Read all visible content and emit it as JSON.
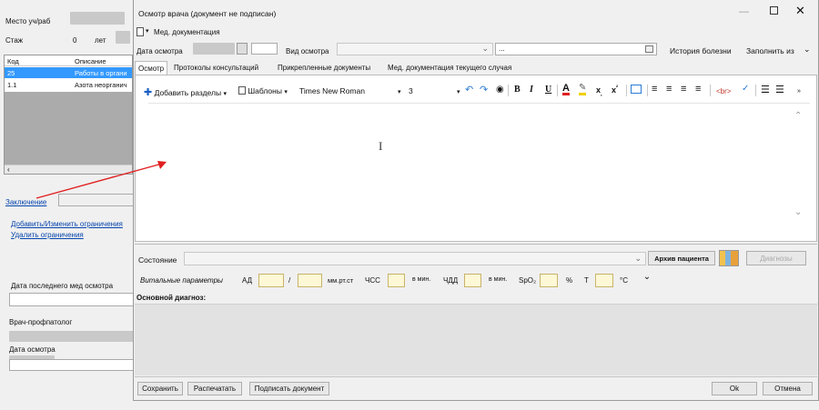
{
  "left": {
    "place_label": "Место уч/раб",
    "experience_label": "Стаж",
    "experience_value": "0",
    "experience_unit": "лет",
    "table": {
      "headers": [
        "Код",
        "Описание"
      ],
      "rows": [
        {
          "code": "25",
          "desc": "Работы в органи"
        },
        {
          "code": "1.1",
          "desc": "Азота неорганич"
        }
      ]
    },
    "conclusion_link": "Заключение",
    "add_restrictions_link": "Добавить/Изменить ограничения",
    "remove_restrictions_link": "Удалить ограничения",
    "last_exam_label": "Дата последнего мед осмотра",
    "pathologist_label": "Врач-профпатолог",
    "exam_date_label": "Дата осмотра"
  },
  "dialog": {
    "title": "Осмотр врача (документ не подписан)",
    "menu_label": "Мед. документация",
    "exam_date_label": "Дата осмотра",
    "exam_type_label": "Вид осмотра",
    "exam_type_value2": "...",
    "history_button": "История болезни",
    "fill_from_button": "Заполнить из",
    "tabs": [
      "Осмотр",
      "Протоколы консультаций",
      "Прикрепленные документы",
      "Мед. документация текущего случая"
    ],
    "toolbar": {
      "add_sections": "Добавить разделы",
      "templates": "Шаблоны",
      "font": "Times New Roman",
      "size": "3",
      "bold": "B",
      "italic": "I",
      "underline": "U",
      "br_tag": "<br>"
    },
    "state_label": "Состояние",
    "archive_button": "Архив пациента",
    "diagnoses_button": "Диагнозы",
    "vitals": {
      "label": "Витальные параметры",
      "ad": "АД",
      "slash": "/",
      "mmhg": "мм.рт.ст",
      "hr": "ЧСС",
      "per_min": "в мин.",
      "rr": "ЧДД",
      "per_min2": "в мин.",
      "spo2": "SpO₂",
      "percent": "%",
      "temp": "Т",
      "celsius": "°С"
    },
    "main_diagnosis_label": "Основной диагноз:",
    "buttons": {
      "save": "Сохранить",
      "print": "Распечатать",
      "sign": "Подписать документ",
      "ok": "Ok",
      "cancel": "Отмена"
    },
    "colors": {
      "selected_row": "#3399ff",
      "arrow": "#e02020",
      "vital_box": "#fff8d6"
    }
  }
}
